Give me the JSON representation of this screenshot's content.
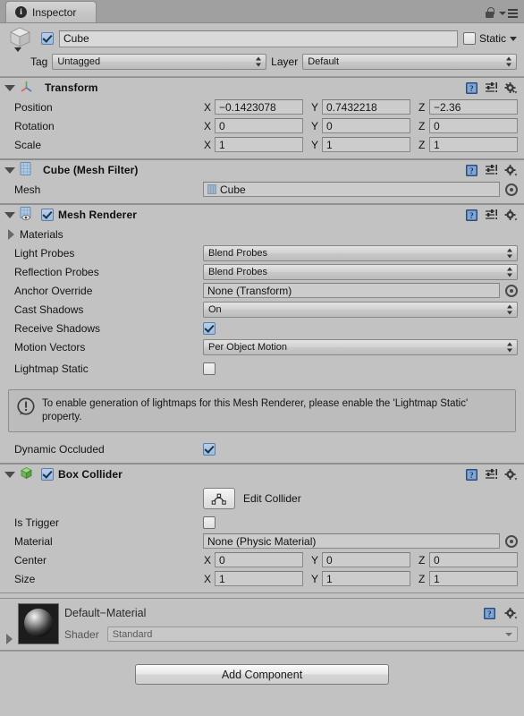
{
  "window": {
    "tab_label": "Inspector",
    "tab_icon": "info-icon",
    "lock_icon": "lock-icon",
    "menu_icon": "hamburger-menu-icon"
  },
  "gameobject": {
    "enabled": true,
    "icon": "cube-gameobject-icon",
    "name": "Cube",
    "static_label": "Static",
    "static_checked": false,
    "tag_label": "Tag",
    "tag_value": "Untagged",
    "layer_label": "Layer",
    "layer_value": "Default"
  },
  "components": [
    {
      "id": "transform",
      "title": "Transform",
      "icon": "transform-axis-icon",
      "expanded": true,
      "has_checkbox": false,
      "header_icons": [
        "help-icon",
        "preset-icon",
        "gear-icon"
      ],
      "vectors": [
        {
          "label": "Position",
          "x": "−0.1423078",
          "y": "0.7432218",
          "z": "−2.36"
        },
        {
          "label": "Rotation",
          "x": "0",
          "y": "0",
          "z": "0"
        },
        {
          "label": "Scale",
          "x": "1",
          "y": "1",
          "z": "1"
        }
      ],
      "axis_labels": {
        "x": "X",
        "y": "Y",
        "z": "Z"
      }
    },
    {
      "id": "mesh-filter",
      "title": "Cube (Mesh Filter)",
      "icon": "mesh-filter-icon",
      "expanded": true,
      "has_checkbox": false,
      "header_icons": [
        "help-icon",
        "preset-icon",
        "gear-icon"
      ],
      "mesh_label": "Mesh",
      "mesh_value": "Cube"
    },
    {
      "id": "mesh-renderer",
      "title": "Mesh Renderer",
      "icon": "mesh-renderer-icon",
      "expanded": true,
      "has_checkbox": true,
      "checked": true,
      "header_icons": [
        "help-icon",
        "preset-icon",
        "gear-icon"
      ],
      "materials_label": "Materials",
      "materials_expanded": false,
      "fields": [
        {
          "label": "Light Probes",
          "type": "popup",
          "value": "Blend Probes"
        },
        {
          "label": "Reflection Probes",
          "type": "popup",
          "value": "Blend Probes"
        },
        {
          "label": "Anchor Override",
          "type": "object",
          "value": "None (Transform)"
        },
        {
          "label": "Cast Shadows",
          "type": "popup",
          "value": "On"
        },
        {
          "label": "Receive Shadows",
          "type": "checkbox",
          "checked": true
        },
        {
          "label": "Motion Vectors",
          "type": "popup",
          "value": "Per Object Motion"
        },
        {
          "label": "Lightmap Static",
          "type": "checkbox",
          "checked": false
        }
      ],
      "helpbox": {
        "icon": "warning-icon",
        "text": "To enable generation of lightmaps for this Mesh Renderer, please enable the 'Lightmap Static' property."
      },
      "trailing_fields": [
        {
          "label": "Dynamic Occluded",
          "type": "checkbox",
          "checked": true
        }
      ]
    },
    {
      "id": "box-collider",
      "title": "Box Collider",
      "icon": "box-collider-icon",
      "expanded": true,
      "has_checkbox": true,
      "checked": true,
      "header_icons": [
        "help-icon",
        "preset-icon",
        "gear-icon"
      ],
      "edit_collider_label": "Edit Collider",
      "edit_collider_icon": "polygon-edit-icon",
      "fields": [
        {
          "label": "Is Trigger",
          "type": "checkbox",
          "checked": false
        },
        {
          "label": "Material",
          "type": "object",
          "value": "None (Physic Material)"
        }
      ],
      "vectors": [
        {
          "label": "Center",
          "x": "0",
          "y": "0",
          "z": "0"
        },
        {
          "label": "Size",
          "x": "1",
          "y": "1",
          "z": "1"
        }
      ]
    }
  ],
  "material_preview": {
    "name": "Default−Material",
    "thumb_icon": "material-sphere-preview",
    "shader_label": "Shader",
    "shader_value": "Standard",
    "header_icons": [
      "help-icon",
      "gear-icon"
    ],
    "foldout_expanded": false
  },
  "footer": {
    "add_component_label": "Add Component"
  },
  "colors": {
    "panel_bg": "#c2c2c2",
    "tabbar_bg": "#a0a0a0",
    "field_bg": "#cccccc",
    "checkbox_on": "#9dbbdd",
    "separator": "#8f8f8f"
  }
}
